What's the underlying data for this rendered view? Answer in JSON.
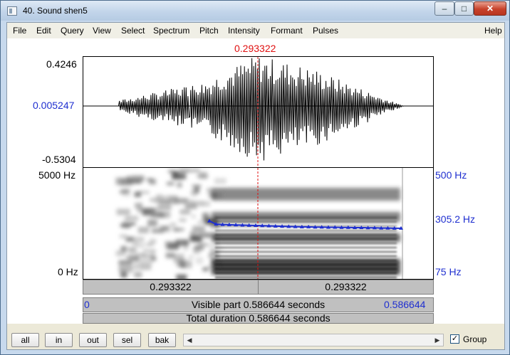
{
  "window": {
    "title": "40. Sound shen5",
    "min_glyph": "–",
    "max_glyph": "□",
    "close_glyph": "✕"
  },
  "menu": {
    "items": [
      "File",
      "Edit",
      "Query",
      "View",
      "Select",
      "Spectrum",
      "Pitch",
      "Intensity",
      "Formant",
      "Pulses"
    ],
    "help": "Help"
  },
  "waveform": {
    "cursor_time": "0.293322",
    "amp_max": "0.4246",
    "amp_cursor": "0.005247",
    "amp_min": "-0.5304"
  },
  "spectrogram": {
    "freq_max": "5000 Hz",
    "freq_min": "0 Hz",
    "pitch_max": "500 Hz",
    "pitch_value": "305.2 Hz",
    "pitch_min": "75 Hz"
  },
  "pitch_track_hz": [
    330,
    314,
    312,
    311,
    310,
    309,
    308,
    307,
    306,
    305,
    304,
    303,
    302,
    301,
    300,
    300,
    299,
    299,
    298,
    298,
    297,
    297,
    296,
    296,
    295,
    295,
    294,
    294,
    293,
    293
  ],
  "time_bars": {
    "left_segment": "0.293322",
    "right_segment": "0.293322",
    "visible_start": "0",
    "visible_label": "Visible part 0.586644 seconds",
    "visible_end": "0.586644",
    "total_label": "Total duration 0.586644 seconds"
  },
  "toolbar": {
    "buttons": [
      "all",
      "in",
      "out",
      "sel",
      "bak"
    ],
    "scroll_left": "◀",
    "scroll_right": "▶",
    "group_checked": "✓",
    "group_label": "Group"
  },
  "colors": {
    "cursor": "#e01010",
    "pitch": "#1f2fd0",
    "label_blue": "#1f2fd0"
  }
}
